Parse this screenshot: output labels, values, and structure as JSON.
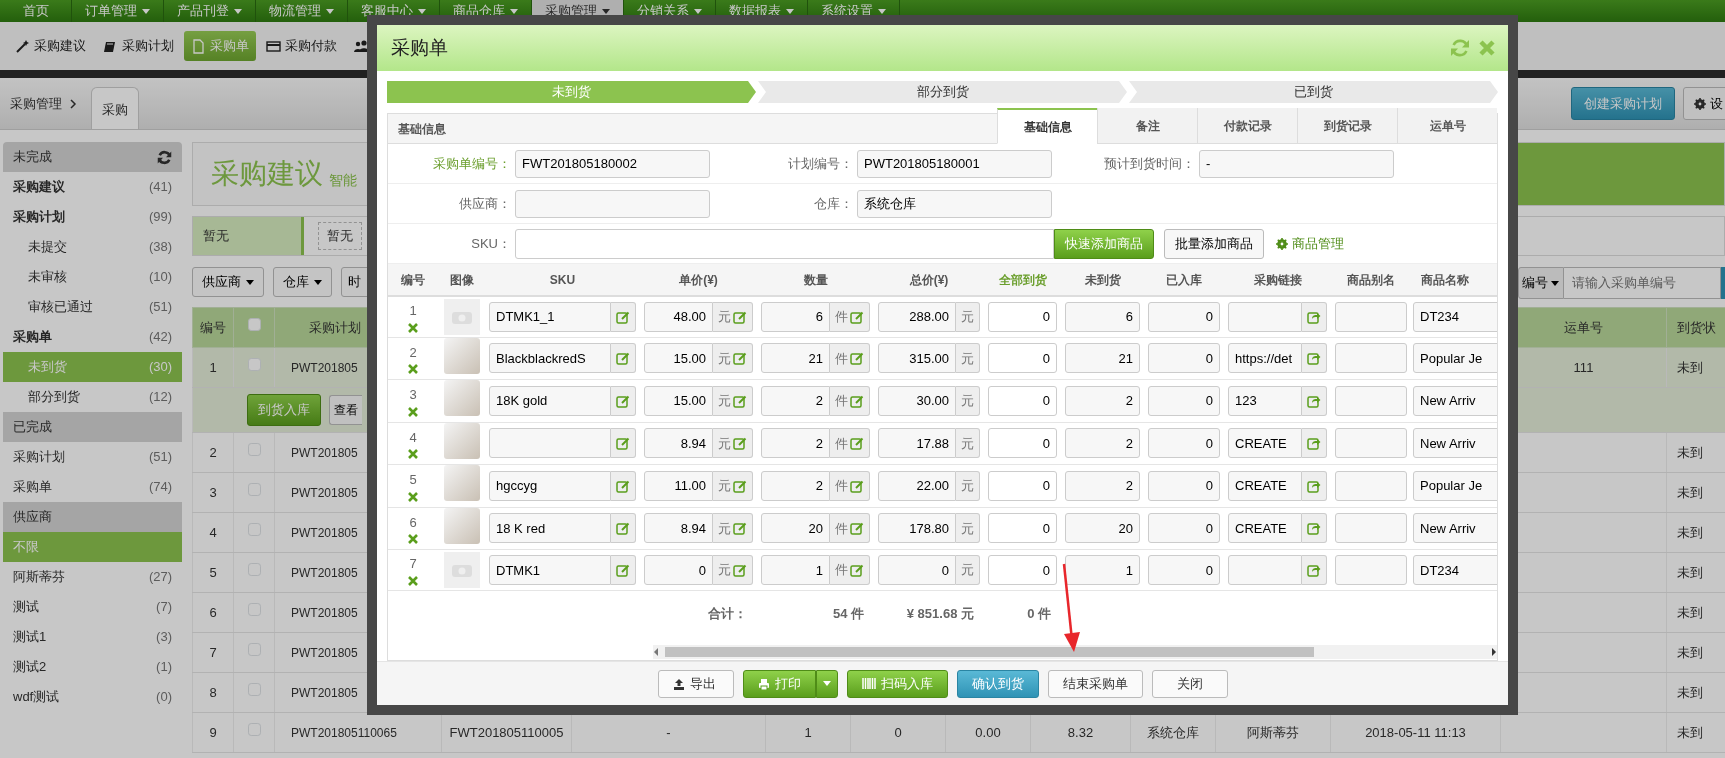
{
  "top_nav": [
    {
      "label": "首页",
      "dropdown": false,
      "selected": false
    },
    {
      "label": "订单管理",
      "dropdown": true,
      "selected": false
    },
    {
      "label": "产品刊登",
      "dropdown": true,
      "selected": false
    },
    {
      "label": "物流管理",
      "dropdown": true,
      "selected": false
    },
    {
      "label": "客服中心",
      "dropdown": true,
      "selected": false
    },
    {
      "label": "商品仓库",
      "dropdown": true,
      "selected": false
    },
    {
      "label": "采购管理",
      "dropdown": true,
      "selected": true
    },
    {
      "label": "分销关系",
      "dropdown": true,
      "selected": false
    },
    {
      "label": "数据报表",
      "dropdown": true,
      "selected": false
    },
    {
      "label": "系统设置",
      "dropdown": true,
      "selected": false
    }
  ],
  "sub_nav": [
    {
      "label": "采购建议",
      "selected": false
    },
    {
      "label": "采购计划",
      "selected": false
    },
    {
      "label": "采购单",
      "selected": true
    },
    {
      "label": "采购付款",
      "selected": false
    },
    {
      "selected": false
    }
  ],
  "breadcrumb": {
    "parent": "采购管理",
    "tab": "采购"
  },
  "header_buttons": [
    {
      "kind": "primary",
      "label": "创建采购计划"
    },
    {
      "kind": "settings",
      "label": "设"
    }
  ],
  "sidebar": [
    {
      "title": "未完成",
      "refresh": true,
      "items": [
        {
          "label": "采购建议",
          "count": "(41)",
          "bold": true,
          "selected": false
        },
        {
          "label": "采购计划",
          "count": "(99)",
          "bold": true,
          "selected": false,
          "children": [
            {
              "label": "未提交",
              "count": "(38)",
              "bold": false,
              "selected": false
            },
            {
              "label": "未审核",
              "count": "(10)",
              "bold": false,
              "selected": false
            },
            {
              "label": "审核已通过",
              "count": "(51)",
              "bold": false,
              "selected": false
            }
          ]
        },
        {
          "label": "采购单",
          "count": "(42)",
          "bold": true,
          "selected": false,
          "children": [
            {
              "label": "未到货",
              "count": "(30)",
              "bold": false,
              "selected": true
            },
            {
              "label": "部分到货",
              "count": "(12)",
              "bold": false,
              "selected": false
            }
          ]
        }
      ]
    },
    {
      "title": "已完成",
      "refresh": false,
      "items": [
        {
          "label": "采购计划",
          "count": "(51)",
          "bold": false,
          "selected": false
        },
        {
          "label": "采购单",
          "count": "(74)",
          "bold": false,
          "selected": false
        }
      ]
    },
    {
      "title": "供应商",
      "refresh": false,
      "items": [
        {
          "label": "不限",
          "bold": false,
          "selected": true
        },
        {
          "label": "阿斯蒂芬",
          "count": "(27)",
          "bold": false,
          "selected": false
        },
        {
          "label": "测试",
          "count": "(7)",
          "bold": false,
          "selected": false
        },
        {
          "label": "测试1",
          "count": "(3)",
          "bold": false,
          "selected": false
        },
        {
          "label": "测试2",
          "count": "(1)",
          "bold": false,
          "selected": false
        },
        {
          "label": "wdf测试",
          "count": "(0)",
          "bold": false,
          "selected": false
        }
      ]
    }
  ],
  "main": {
    "title": "采购建议",
    "subtitle": "智能",
    "tag_label": "暂无",
    "tag": "暂无",
    "filters": [
      "供应商",
      "仓库",
      "时"
    ],
    "search": {
      "field": "编号",
      "placeholder": "请输入采购单编号"
    },
    "table": {
      "header": {
        "number": "编号",
        "select_all_checked": false,
        "plan_no": "采购计划",
        "waybill": "运单号",
        "status": "到货状"
      },
      "rows": [
        {
          "number": "1",
          "checked": false,
          "plan_no": "PWT201805",
          "waybill": "111",
          "status": "未到",
          "expanded": true,
          "actions": [
            "到货入库",
            "查看"
          ]
        },
        {
          "number": "2",
          "checked": false,
          "plan_no": "PWT201805",
          "status": "未到",
          "expanded": false
        },
        {
          "number": "3",
          "checked": false,
          "plan_no": "PWT201805",
          "status": "未到",
          "expanded": false
        },
        {
          "number": "4",
          "checked": false,
          "plan_no": "PWT201805",
          "status": "未到",
          "expanded": false
        },
        {
          "number": "5",
          "checked": false,
          "plan_no": "PWT201805",
          "status": "未到",
          "expanded": false
        },
        {
          "number": "6",
          "checked": false,
          "plan_no": "PWT201805",
          "status": "未到",
          "expanded": false
        },
        {
          "number": "7",
          "checked": false,
          "plan_no": "PWT201805",
          "status": "未到",
          "expanded": false
        },
        {
          "number": "8",
          "checked": false,
          "plan_no": "PWT201805",
          "status": "未到",
          "expanded": false
        },
        {
          "number": "9",
          "checked": false,
          "plan_no": "PWT201805110065",
          "details": [
            "FWT201805110005",
            "-",
            "1",
            "0",
            "0.00",
            "8.32",
            "系统仓库",
            "阿斯蒂芬",
            "2018-05-11 11:13"
          ],
          "status": "未到",
          "expanded": false
        }
      ]
    }
  },
  "modal": {
    "title": "采购单",
    "steps": [
      {
        "label": "未到货",
        "selected": true
      },
      {
        "label": "部分到货",
        "selected": false
      },
      {
        "label": "已到货",
        "selected": false
      }
    ],
    "panel_title": "基础信息",
    "tabs": [
      {
        "label": "基础信息",
        "selected": true
      },
      {
        "label": "备注",
        "selected": false
      },
      {
        "label": "付款记录",
        "selected": false
      },
      {
        "label": "到货记录",
        "selected": false
      },
      {
        "label": "运单号",
        "selected": false
      }
    ],
    "form_rows": [
      [
        {
          "label": "采购单编号：",
          "value": "FWT201805180002",
          "highlighted": true
        },
        {
          "label": "计划编号：",
          "value": "PWT201805180001",
          "highlighted": false
        },
        {
          "label": "预计到货时间：",
          "value": "-",
          "highlighted": false
        }
      ],
      [
        {
          "label": "供应商：",
          "highlighted": false
        },
        {
          "label": "仓库：",
          "value": "系统仓库",
          "highlighted": false
        }
      ]
    ],
    "sku": {
      "label": "SKU：",
      "quick_add": "快速添加商品",
      "bulk_add": "批量添加商品",
      "manage": "商品管理"
    },
    "columns": [
      {
        "label": "编号",
        "highlighted": false
      },
      {
        "label": "图像",
        "highlighted": false
      },
      {
        "label": "SKU",
        "highlighted": false
      },
      {
        "label": "单价(¥)",
        "highlighted": false
      },
      {
        "label": "数量",
        "highlighted": false
      },
      {
        "label": "总价(¥)",
        "highlighted": false
      },
      {
        "label": "全部到货",
        "highlighted": true
      },
      {
        "label": "未到货",
        "highlighted": false
      },
      {
        "label": "已入库",
        "highlighted": false
      },
      {
        "label": "采购链接",
        "highlighted": false
      },
      {
        "label": "商品别名",
        "highlighted": false
      },
      {
        "label": "商品名称",
        "highlighted": false
      }
    ],
    "items": [
      {
        "number": "1",
        "kind": "placeholder",
        "sku": "DTMK1_1",
        "price": "48.00",
        "price_unit": "元",
        "qty": "6",
        "qty_unit": "件",
        "total": "288.00",
        "total_unit": "元",
        "arrived": "0",
        "pending": "6",
        "stocked": "0",
        "name": "DT234"
      },
      {
        "number": "2",
        "kind": "photo",
        "sku": "BlackblackredS",
        "price": "15.00",
        "price_unit": "元",
        "qty": "21",
        "qty_unit": "件",
        "total": "315.00",
        "total_unit": "元",
        "arrived": "0",
        "pending": "21",
        "stocked": "0",
        "link": "https://det",
        "name": "Popular Je"
      },
      {
        "number": "3",
        "kind": "photo",
        "sku": "18K gold",
        "price": "15.00",
        "price_unit": "元",
        "qty": "2",
        "qty_unit": "件",
        "total": "30.00",
        "total_unit": "元",
        "arrived": "0",
        "pending": "2",
        "stocked": "0",
        "link": "123",
        "name": "New Arriv"
      },
      {
        "number": "4",
        "kind": "photo",
        "price": "8.94",
        "price_unit": "元",
        "qty": "2",
        "qty_unit": "件",
        "total": "17.88",
        "total_unit": "元",
        "arrived": "0",
        "pending": "2",
        "stocked": "0",
        "link": "CREATE",
        "name": "New Arriv"
      },
      {
        "number": "5",
        "kind": "photo",
        "sku": "hgccyg",
        "price": "11.00",
        "price_unit": "元",
        "qty": "2",
        "qty_unit": "件",
        "total": "22.00",
        "total_unit": "元",
        "arrived": "0",
        "pending": "2",
        "stocked": "0",
        "link": "CREATE",
        "name": "Popular Je"
      },
      {
        "number": "6",
        "kind": "photo",
        "sku": "18 K red",
        "price": "8.94",
        "price_unit": "元",
        "qty": "20",
        "qty_unit": "件",
        "total": "178.80",
        "total_unit": "元",
        "arrived": "0",
        "pending": "20",
        "stocked": "0",
        "link": "CREATE",
        "name": "New Arriv"
      },
      {
        "number": "7",
        "kind": "placeholder",
        "sku": "DTMK1",
        "price": "0",
        "price_unit": "元",
        "qty": "1",
        "qty_unit": "件",
        "total": "0",
        "total_unit": "元",
        "arrived": "0",
        "pending": "1",
        "stocked": "0",
        "name": "DT234"
      }
    ],
    "totals": {
      "label": "合计：",
      "qty": "54 件",
      "amount": "¥ 851.68 元",
      "arrived": "0 件"
    },
    "footer_buttons": [
      {
        "kind": "export",
        "label": "导出"
      },
      {
        "kind": "print",
        "label": "打印"
      },
      {
        "kind": "scan",
        "label": "扫码入库"
      },
      {
        "kind": "confirm",
        "label": "确认到货"
      },
      {
        "kind": "plain",
        "label": "结束采购单"
      },
      {
        "kind": "plain",
        "label": "关闭"
      }
    ]
  }
}
